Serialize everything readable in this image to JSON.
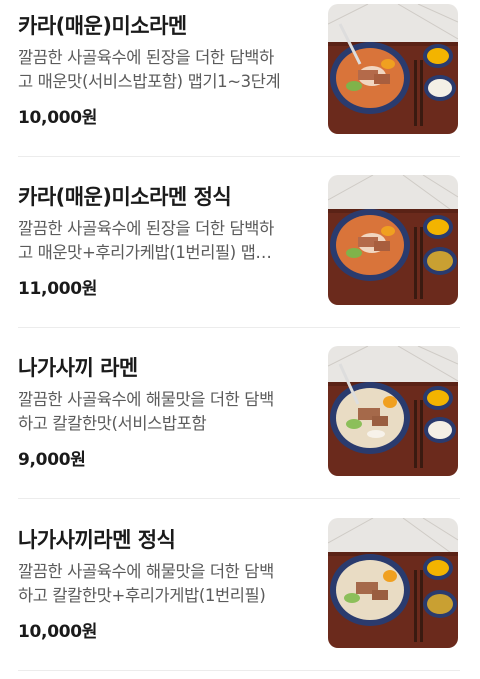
{
  "menu": {
    "items": [
      {
        "title": "카라(매운)미소라멘",
        "desc_line1": "깔끔한 사골육수에 된장을 더한 담백하",
        "desc_line2": "고 매운맛(서비스밥포함) 맵기1~3단계",
        "price": "10,000원",
        "image": "spicy-miso-ramen-photo"
      },
      {
        "title": "카라(매운)미소라멘 정식",
        "desc_line1": "깔끔한 사골육수에 된장을 더한 담백하",
        "desc_line2": "고 매운맛+후리가케밥(1번리필) 맵…",
        "price": "11,000원",
        "image": "spicy-miso-ramen-set-photo"
      },
      {
        "title": "나가사끼 라멘",
        "desc_line1": "깔끔한 사골육수에 해물맛을 더한 담백",
        "desc_line2": "하고 칼칼한맛(서비스밥포함",
        "price": "9,000원",
        "image": "nagasaki-ramen-photo"
      },
      {
        "title": "나가사끼라멘 정식",
        "desc_line1": "깔끔한 사골육수에 해물맛을 더한 담백",
        "desc_line2": "하고 칼칼한맛+후리가게밥(1번리필)",
        "price": "10,000원",
        "image": "nagasaki-ramen-set-photo"
      }
    ]
  },
  "colors": {
    "title": "#1a1a1a",
    "description": "#5b5b5b",
    "divider": "#ececec",
    "tray": "#6b2a1c",
    "spicy_broth": "#d9743a",
    "white_broth": "#e9dcc4"
  }
}
